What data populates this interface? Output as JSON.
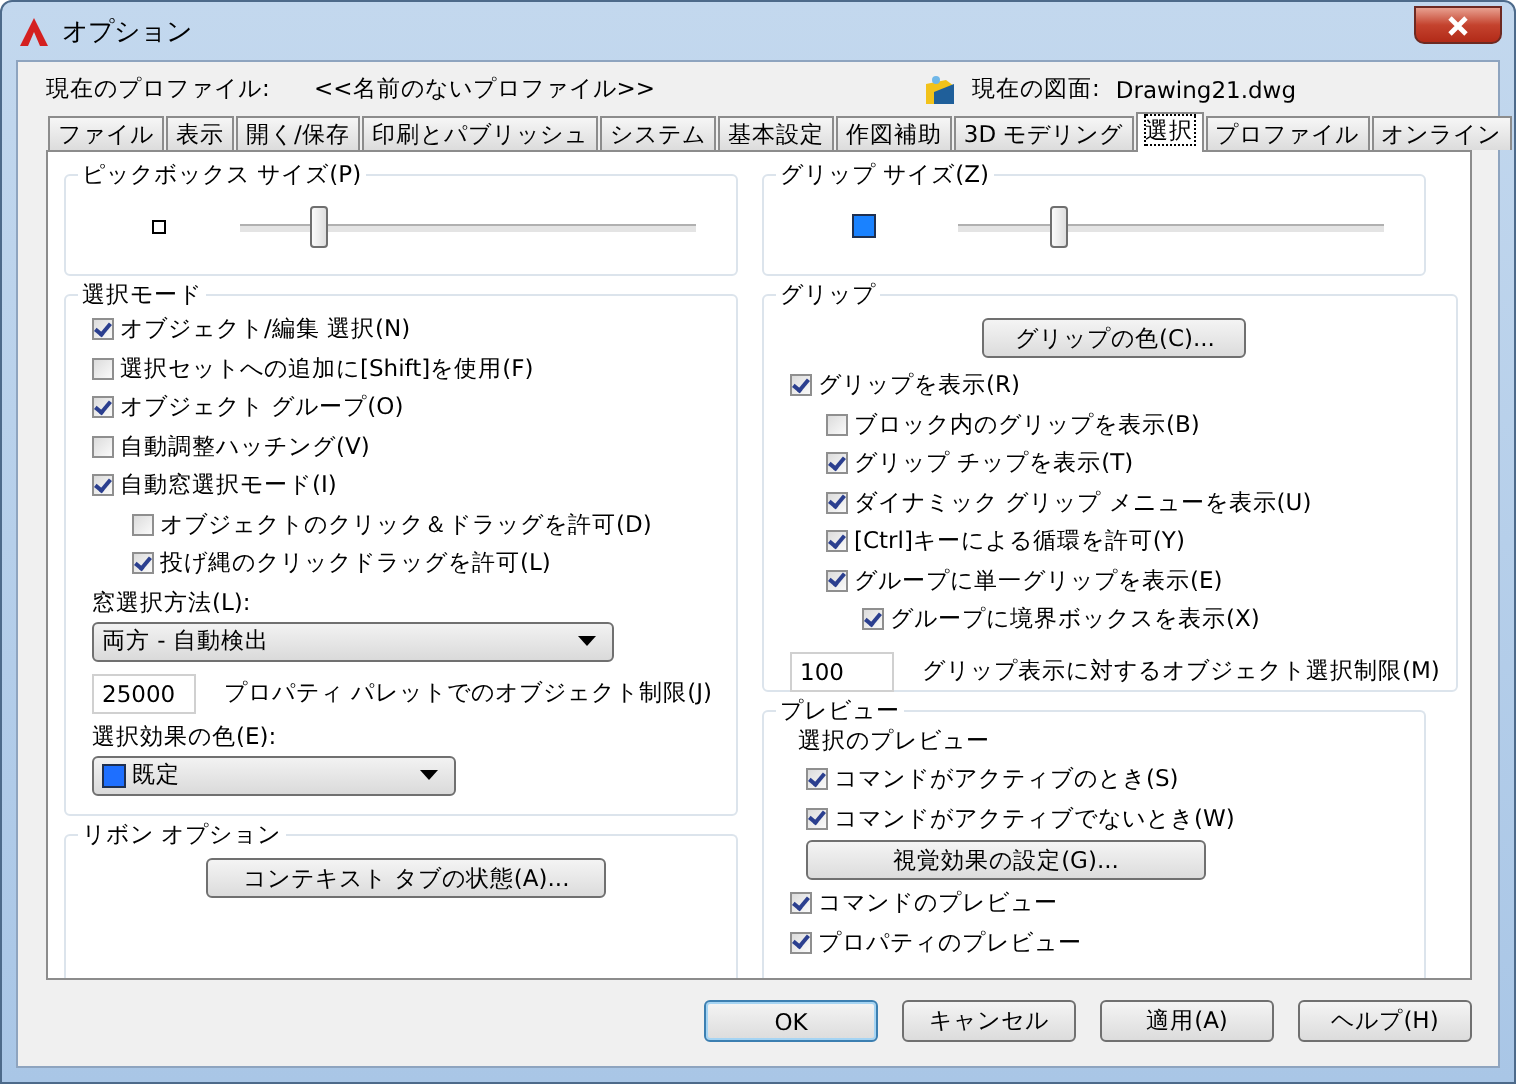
{
  "window": {
    "title": "オプション"
  },
  "profile": {
    "label": "現在のプロファイル:",
    "value": "<<名前のないプロファイル>>",
    "drawing_label": "現在の図面:",
    "drawing_value": "Drawing21.dwg"
  },
  "tabs": [
    {
      "label": "ファイル",
      "selected": false
    },
    {
      "label": "表示",
      "selected": false
    },
    {
      "label": "開く/保存",
      "selected": false
    },
    {
      "label": "印刷とパブリッシュ",
      "selected": false
    },
    {
      "label": "システム",
      "selected": false
    },
    {
      "label": "基本設定",
      "selected": false
    },
    {
      "label": "作図補助",
      "selected": false
    },
    {
      "label": "3D モデリング",
      "selected": false
    },
    {
      "label": "選択",
      "selected": true
    },
    {
      "label": "プロファイル",
      "selected": false
    },
    {
      "label": "オンライン",
      "selected": false
    }
  ],
  "pickbox": {
    "title": "ピックボックス サイズ(P)",
    "level": 0.16
  },
  "selection_modes": {
    "title": "選択モード",
    "options": [
      {
        "label": "オブジェクト/編集 選択(N)",
        "checked": true
      },
      {
        "label": "選択セットへの追加に[Shift]を使用(F)",
        "checked": false
      },
      {
        "label": "オブジェクト グループ(O)",
        "checked": true
      },
      {
        "label": "自動調整ハッチング(V)",
        "checked": false
      },
      {
        "label": "自動窓選択モード(I)",
        "checked": true,
        "children": [
          {
            "label": "オブジェクトのクリック＆ドラッグを許可(D)",
            "checked": false
          },
          {
            "label": "投げ縄のクリックドラッグを許可(L)",
            "checked": true
          }
        ]
      }
    ],
    "window_method": {
      "label": "窓選択方法(L):",
      "value": "両方 - 自動検出"
    },
    "object_limit": {
      "value": "25000",
      "label": "プロパティ パレットでのオブジェクト制限(J)"
    },
    "effect_color": {
      "label": "選択効果の色(E):",
      "value": "既定"
    }
  },
  "ribbon": {
    "title": "リボン オプション",
    "button": "コンテキスト タブの状態(A)..."
  },
  "grip_size": {
    "title": "グリップ サイズ(Z)",
    "level": 0.22
  },
  "grips": {
    "title": "グリップ",
    "color_button": "グリップの色(C)...",
    "options": [
      {
        "label": "グリップを表示(R)",
        "checked": true,
        "children": [
          {
            "label": "ブロック内のグリップを表示(B)",
            "checked": false
          },
          {
            "label": "グリップ チップを表示(T)",
            "checked": true
          },
          {
            "label": "ダイナミック グリップ メニューを表示(U)",
            "checked": true
          },
          {
            "label": "[Ctrl]キーによる循環を許可(Y)",
            "checked": true
          },
          {
            "label": "グループに単一グリップを表示(E)",
            "checked": true,
            "children": [
              {
                "label": "グループに境界ボックスを表示(X)",
                "checked": true
              }
            ]
          }
        ]
      }
    ],
    "limit": {
      "value": "100",
      "label": "グリップ表示に対するオブジェクト選択制限(M)"
    }
  },
  "preview": {
    "title": "プレビュー",
    "subtitle": "選択のプレビュー",
    "selection_options": [
      {
        "label": "コマンドがアクティブのとき(S)",
        "checked": true
      },
      {
        "label": "コマンドがアクティブでないとき(W)",
        "checked": true
      }
    ],
    "visual_button": "視覚効果の設定(G)...",
    "options": [
      {
        "label": "コマンドのプレビュー",
        "checked": true
      },
      {
        "label": "プロパティのプレビュー",
        "checked": true
      }
    ]
  },
  "buttons": [
    {
      "label": "OK",
      "default": true
    },
    {
      "label": "キャンセル",
      "default": false
    },
    {
      "label": "適用(A)",
      "default": false
    },
    {
      "label": "ヘルプ(H)",
      "default": false
    }
  ]
}
